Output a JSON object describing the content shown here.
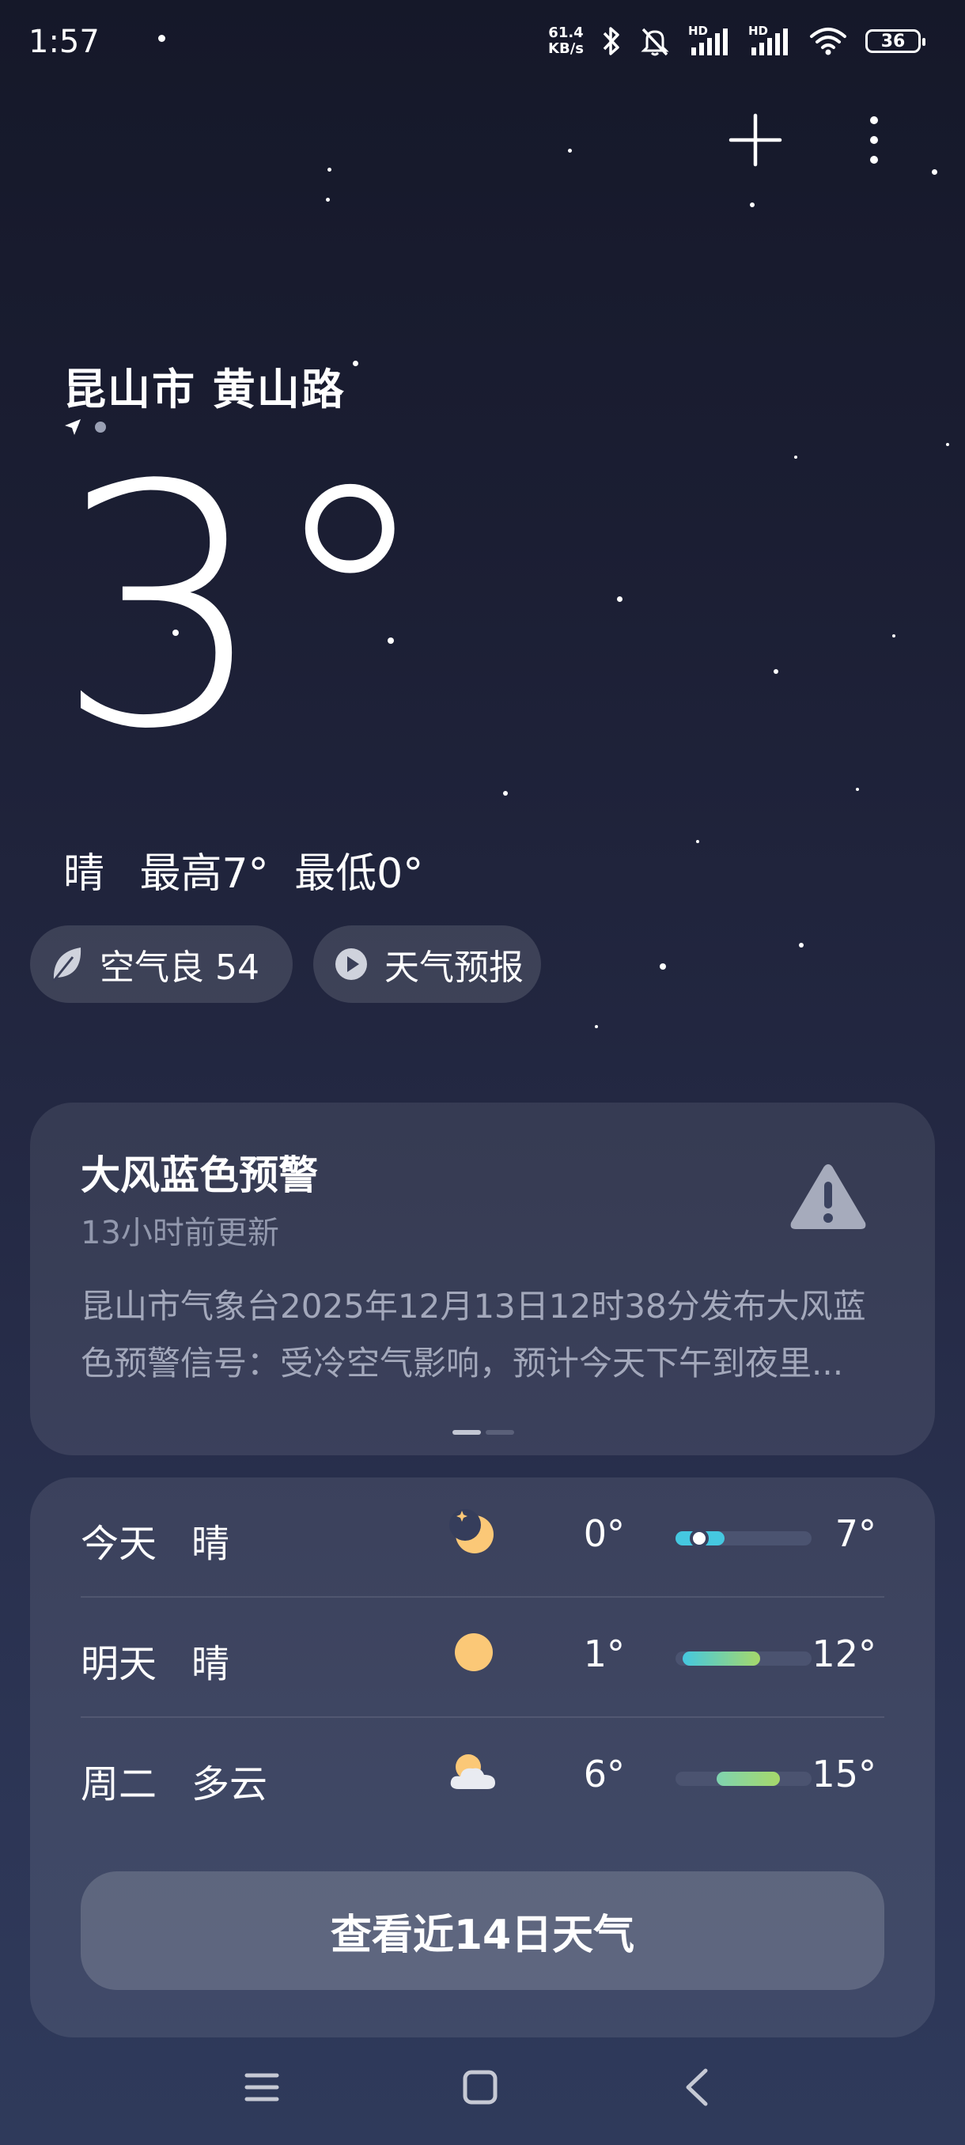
{
  "status_bar": {
    "time": "1:57",
    "net_speed_value": "61.4",
    "net_speed_unit": "KB/s",
    "signal1_tag": "HD",
    "signal2_tag": "HD",
    "battery": "36",
    "icons": [
      "bluetooth-icon",
      "mute-bell-icon",
      "signal-icon",
      "signal-icon",
      "wifi-icon",
      "battery-icon"
    ]
  },
  "header": {
    "actions": [
      "add-icon",
      "more-icon"
    ]
  },
  "current": {
    "location": "昆山市 黄山路",
    "temperature": "3°",
    "condition": "晴",
    "high": "最高7°",
    "low": "最低0°"
  },
  "chips": {
    "aqi_label": "空气良 54",
    "forecast_label": "天气预报"
  },
  "alert": {
    "title": "大风蓝色预警",
    "updated": "13小时前更新",
    "body": "昆山市气象台2025年12月13日12时38分发布大风蓝色预警信号：受冷空气影响，预计今天下午到夜里..."
  },
  "forecast": {
    "days": [
      {
        "day": "今天",
        "condition": "晴",
        "icon": "moon-icon",
        "low": "0°",
        "high": "7°",
        "bar_start": 0.0,
        "bar_end": 0.36
      },
      {
        "day": "明天",
        "condition": "晴",
        "icon": "sun-icon",
        "low": "1°",
        "high": "12°",
        "bar_start": 0.05,
        "bar_end": 0.62
      },
      {
        "day": "周二",
        "condition": "多云",
        "icon": "partly-cloudy-icon",
        "low": "6°",
        "high": "15°",
        "bar_start": 0.3,
        "bar_end": 0.77
      }
    ],
    "more_button": "查看近14日天气"
  },
  "colors": {
    "cold_bar": "#45c8e0",
    "warm_bar": "#a6d86a",
    "sun": "#fbc877"
  }
}
